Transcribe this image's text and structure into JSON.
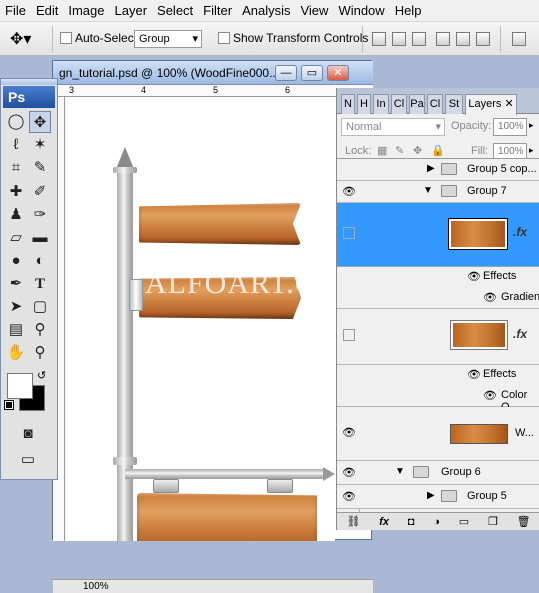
{
  "menubar": [
    "File",
    "Edit",
    "Image",
    "Layer",
    "Select",
    "Filter",
    "Analysis",
    "View",
    "Window",
    "Help"
  ],
  "options": {
    "auto_select_label": "Auto-Select:",
    "auto_select_value": "Group",
    "show_transform_label": "Show Transform Controls"
  },
  "document": {
    "title": "gn_tutorial.psd @ 100% (WoodFine000...",
    "ruler_numbers": [
      "3",
      "4",
      "5",
      "6"
    ],
    "zoom": "100%",
    "watermark": "ALFOART.COM"
  },
  "toolbox": {
    "logo": "Ps"
  },
  "panel": {
    "tabs": [
      "N",
      "H",
      "In",
      "Cl",
      "Pa",
      "Cl",
      "St",
      "Layers"
    ],
    "blend_mode": "Normal",
    "opacity_label": "Opacity:",
    "opacity": "100%",
    "lock_label": "Lock:",
    "fill_label": "Fill:",
    "fill": "100%",
    "layers": [
      {
        "name": "Group 5 cop..."
      },
      {
        "name": "Group 7"
      },
      {
        "name": "",
        "fx": ".fx"
      },
      {
        "name": "Effects"
      },
      {
        "name": "Gradien..."
      },
      {
        "name": "",
        "fx": ".fx"
      },
      {
        "name": "Effects"
      },
      {
        "name": "Color O..."
      },
      {
        "name": "W..."
      },
      {
        "name": "Group 6"
      },
      {
        "name": "Group 5"
      }
    ],
    "bottom_icons": [
      "link-icon",
      "fx",
      "mask-icon",
      "adjustment-icon",
      "folder-icon",
      "new-layer-icon",
      "trash-icon"
    ]
  }
}
